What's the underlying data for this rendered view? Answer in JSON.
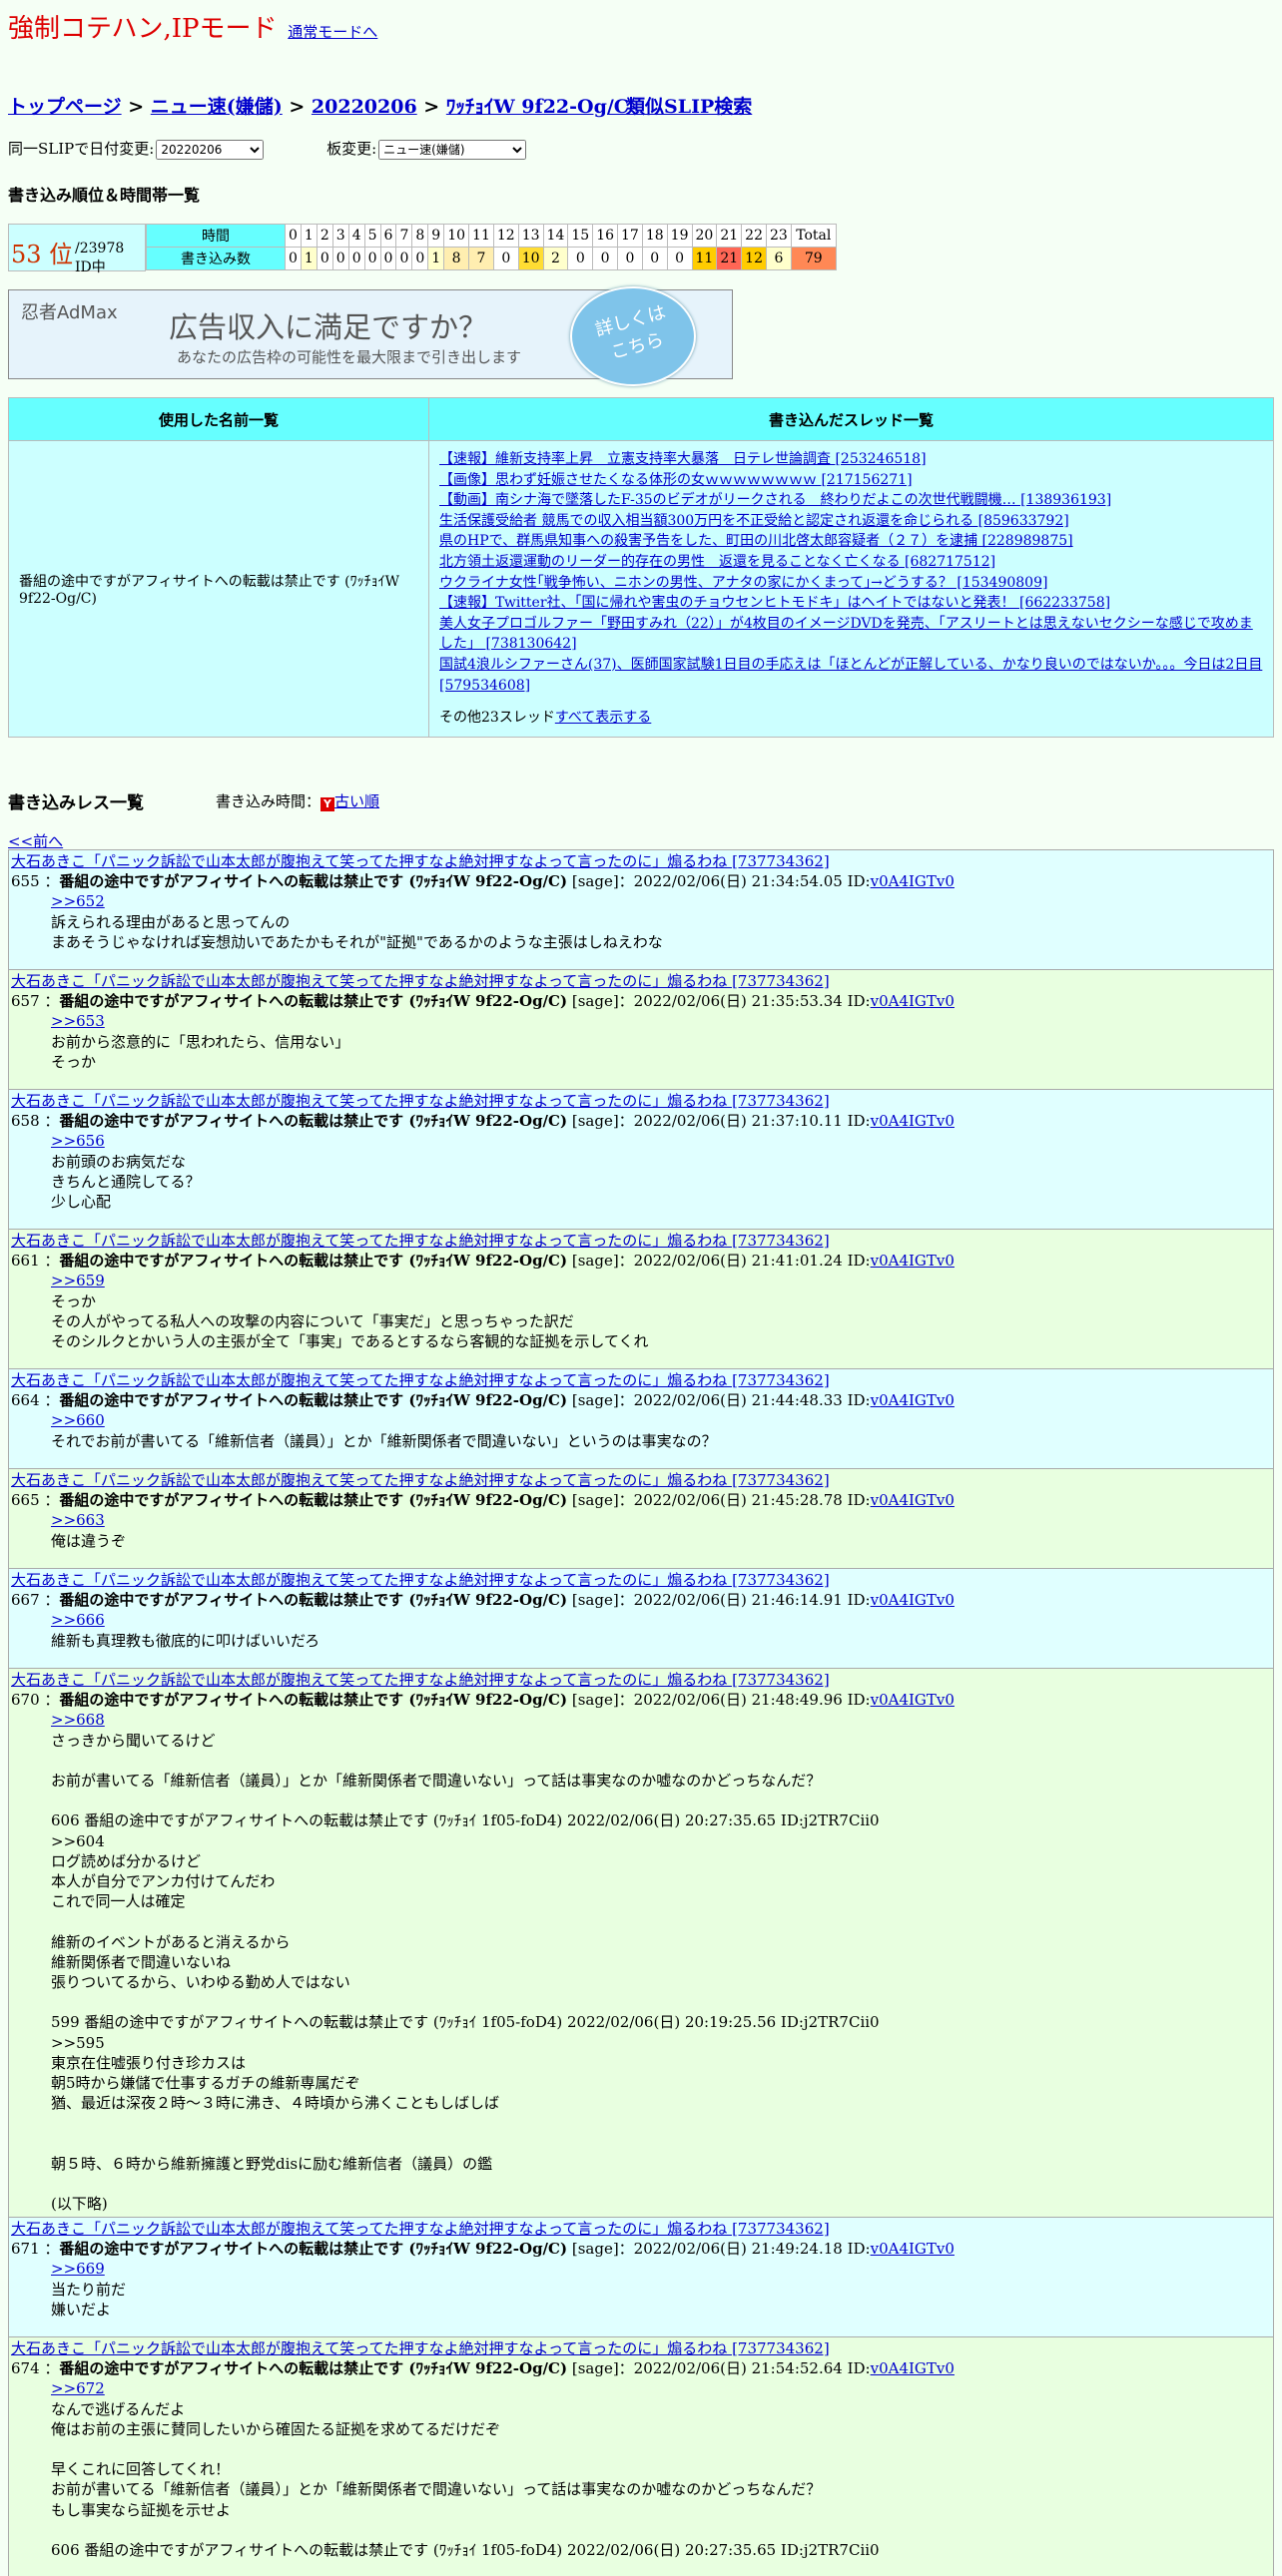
{
  "mode": {
    "title": "強制コテハン,IPモード",
    "normal_link": "通常モードへ"
  },
  "breadcrumb": {
    "top": "トップページ",
    "board": "ニュー速(嫌儲)",
    "date": "20220206",
    "slip": "ﾜｯﾁｮｲW 9f22-Og/C",
    "sep": " > "
  },
  "similar": "類似SLIP検索",
  "selects": {
    "date_label": "同一SLIPで日付変更:",
    "date_value": "20220206",
    "board_label": "板変更:",
    "board_value": "ニュー速(嫌儲)"
  },
  "ranking_title": "書き込み順位＆時間帯一覧",
  "rank": {
    "num": "53 位",
    "total": "/23978 ID中"
  },
  "hours": {
    "label_time": "時間",
    "label_count": "書き込み数",
    "cols": [
      "0",
      "1",
      "2",
      "3",
      "4",
      "5",
      "6",
      "7",
      "8",
      "9",
      "10",
      "11",
      "12",
      "13",
      "14",
      "15",
      "16",
      "17",
      "18",
      "19",
      "20",
      "21",
      "22",
      "23",
      "Total"
    ],
    "counts": [
      "0",
      "1",
      "0",
      "0",
      "0",
      "0",
      "0",
      "0",
      "0",
      "1",
      "8",
      "7",
      "0",
      "10",
      "2",
      "0",
      "0",
      "0",
      "0",
      "0",
      "11",
      "21",
      "12",
      "6",
      "79"
    ],
    "colors": [
      "#ffffff",
      "#ffffcc",
      "#ffffff",
      "#ffffff",
      "#ffffff",
      "#ffffff",
      "#ffffff",
      "#ffffff",
      "#ffffff",
      "#ffffcc",
      "#ffeeb0",
      "#ffeeb0",
      "#ffffff",
      "#ffdd33",
      "#ffffcc",
      "#ffffff",
      "#ffffff",
      "#ffffff",
      "#ffffff",
      "#ffffff",
      "#ffcc00",
      "#ff6655",
      "#ffcc00",
      "#ffffcc",
      "#ff8855"
    ]
  },
  "ad": {
    "logo": "忍者AdMax",
    "title": "広告収入に満足ですか？",
    "sub": "あなたの広告枠の可能性を最大限まで引き出します",
    "circle1": "詳しくは",
    "circle2": "こちら"
  },
  "names_table": {
    "h1": "使用した名前一覧",
    "h2": "書き込んだスレッド一覧",
    "name": "番組の途中ですがアフィサイトへの転載は禁止です (ﾜｯﾁｮｲW 9f22-Og/C)",
    "threads": [
      "【速報】維新支持率上昇　立憲支持率大暴落　日テレ世論調査 [253246518]",
      "【画像】思わず妊娠させたくなる体形の女ｗｗｗｗｗｗｗｗ [217156271]",
      "【動画】南シナ海で墜落したF-35のビデオがリークされる　終わりだよこの次世代戦闘機… [138936193]",
      "生活保護受給者 競馬での収入相当額300万円を不正受給と認定され返還を命じられる [859633792]",
      "県のHPで、群馬県知事への殺害予告をした、町田の川北啓太郎容疑者（２７）を逮捕 [228989875]",
      "北方領土返還運動のリーダー的存在の男性　返還を見ることなく亡くなる [682717512]",
      "ウクライナ女性｢戦争怖い、ニホンの男性、アナタの家にかくまって｣→どうする？ [153490809]",
      "【速報】Twitter社、「国に帰れや害虫のチョウセンヒトモドキ」はヘイトではないと発表！ [662233758]",
      "美人女子プロゴルファー「野田すみれ（22）」が4枚目のイメージDVDを発売、「アスリートとは思えないセクシーな感じで攻めました」 [738130642]",
      "国試4浪ルシファーさん(37)、医師国家試験1日目の手応えは「ほとんどが正解している、かなり良いのではないか。。。今日は2日目 [579534608]"
    ],
    "more_prefix": "その他23スレッド",
    "more_link": "すべて表示する"
  },
  "posts_title": "書き込みレス一覧",
  "order": {
    "label": "書き込み時間：",
    "icon": "Y",
    "link": "古い順"
  },
  "prev": "<<前へ",
  "posts": [
    {
      "thread": "大石あきこ「パニック訴訟で山本太郎が腹抱えて笑ってた押すなよ絶対押すなよって言ったのに」煽るわね [737734362]",
      "num": "655",
      "name": "番組の途中ですがアフィサイトへの転載は禁止です (ﾜｯﾁｮｲW 9f22-Og/C)",
      "meta": " [sage]：2022/02/06(日) 21:34:54.05 ID:",
      "id": "v0A4IGTv0",
      "anchor": ">>652",
      "body": "訴えられる理由があると思ってんの\nまあそうじゃなければ妄想劥いであたかもそれが\"証拠\"であるかのような主張はしねえわな"
    },
    {
      "thread": "大石あきこ「パニック訴訟で山本太郎が腹抱えて笑ってた押すなよ絶対押すなよって言ったのに」煽るわね [737734362]",
      "num": "657",
      "name": "番組の途中ですがアフィサイトへの転載は禁止です (ﾜｯﾁｮｲW 9f22-Og/C)",
      "meta": " [sage]：2022/02/06(日) 21:35:53.34 ID:",
      "id": "v0A4IGTv0",
      "anchor": ">>653",
      "body": "お前から恣意的に「思われたら、信用ない」\nそっか"
    },
    {
      "thread": "大石あきこ「パニック訴訟で山本太郎が腹抱えて笑ってた押すなよ絶対押すなよって言ったのに」煽るわね [737734362]",
      "num": "658",
      "name": "番組の途中ですがアフィサイトへの転載は禁止です (ﾜｯﾁｮｲW 9f22-Og/C)",
      "meta": " [sage]：2022/02/06(日) 21:37:10.11 ID:",
      "id": "v0A4IGTv0",
      "anchor": ">>656",
      "body": "お前頭のお病気だな\nきちんと通院してる？\n少し心配"
    },
    {
      "thread": "大石あきこ「パニック訴訟で山本太郎が腹抱えて笑ってた押すなよ絶対押すなよって言ったのに」煽るわね [737734362]",
      "num": "661",
      "name": "番組の途中ですがアフィサイトへの転載は禁止です (ﾜｯﾁｮｲW 9f22-Og/C)",
      "meta": " [sage]：2022/02/06(日) 21:41:01.24 ID:",
      "id": "v0A4IGTv0",
      "anchor": ">>659",
      "body": "そっか\nその人がやってる私人への攻撃の内容について「事実だ」と思っちゃった訳だ\nそのシルクとかいう人の主張が全て「事実」であるとするなら客観的な証拠を示してくれ"
    },
    {
      "thread": "大石あきこ「パニック訴訟で山本太郎が腹抱えて笑ってた押すなよ絶対押すなよって言ったのに」煽るわね [737734362]",
      "num": "664",
      "name": "番組の途中ですがアフィサイトへの転載は禁止です (ﾜｯﾁｮｲW 9f22-Og/C)",
      "meta": " [sage]：2022/02/06(日) 21:44:48.33 ID:",
      "id": "v0A4IGTv0",
      "anchor": ">>660",
      "body": "それでお前が書いてる「維新信者（議員）」とか「維新関係者で間違いない」というのは事実なの？"
    },
    {
      "thread": "大石あきこ「パニック訴訟で山本太郎が腹抱えて笑ってた押すなよ絶対押すなよって言ったのに」煽るわね [737734362]",
      "num": "665",
      "name": "番組の途中ですがアフィサイトへの転載は禁止です (ﾜｯﾁｮｲW 9f22-Og/C)",
      "meta": " [sage]：2022/02/06(日) 21:45:28.78 ID:",
      "id": "v0A4IGTv0",
      "anchor": ">>663",
      "body": "俺は違うぞ"
    },
    {
      "thread": "大石あきこ「パニック訴訟で山本太郎が腹抱えて笑ってた押すなよ絶対押すなよって言ったのに」煽るわね [737734362]",
      "num": "667",
      "name": "番組の途中ですがアフィサイトへの転載は禁止です (ﾜｯﾁｮｲW 9f22-Og/C)",
      "meta": " [sage]：2022/02/06(日) 21:46:14.91 ID:",
      "id": "v0A4IGTv0",
      "anchor": ">>666",
      "body": "維新も真理教も徹底的に叩けばいいだろ"
    },
    {
      "thread": "大石あきこ「パニック訴訟で山本太郎が腹抱えて笑ってた押すなよ絶対押すなよって言ったのに」煽るわね [737734362]",
      "num": "670",
      "name": "番組の途中ですがアフィサイトへの転載は禁止です (ﾜｯﾁｮｲW 9f22-Og/C)",
      "meta": " [sage]：2022/02/06(日) 21:48:49.96 ID:",
      "id": "v0A4IGTv0",
      "anchor": ">>668",
      "body": "さっきから聞いてるけど\n\nお前が書いてる「維新信者（議員）」とか「維新関係者で間違いない」って話は事実なのか嘘なのかどっちなんだ？\n\n606 番組の途中ですがアフィサイトへの転載は禁止です (ﾜｯﾁｮｲ 1f05-foD4) 2022/02/06(日) 20:27:35.65 ID:j2TR7Cii0\n>>604\nログ読めば分かるけど\n本人が自分でアンカ付けてんだわ\nこれで同一人は確定\n\n維新のイベントがあると消えるから\n維新関係者で間違いないね\n張りついてるから、いわゆる勤め人ではない\n\n599 番組の途中ですがアフィサイトへの転載は禁止です (ﾜｯﾁｮｲ 1f05-foD4) 2022/02/06(日) 20:19:25.56 ID:j2TR7Cii0\n>>595\n東京在住嘘張り付き珍カスは\n朝5時から嫌儲で仕事するガチの維新専属だぞ\n猶、最近は深夜２時～３時に沸き、４時頃から沸くこともしばしば\n\n\n朝５時、６時から維新擁護と野党disに励む維新信者（議員）の鑑\n\n(以下略)"
    },
    {
      "thread": "大石あきこ「パニック訴訟で山本太郎が腹抱えて笑ってた押すなよ絶対押すなよって言ったのに」煽るわね [737734362]",
      "num": "671",
      "name": "番組の途中ですがアフィサイトへの転載は禁止です (ﾜｯﾁｮｲW 9f22-Og/C)",
      "meta": " [sage]：2022/02/06(日) 21:49:24.18 ID:",
      "id": "v0A4IGTv0",
      "anchor": ">>669",
      "body": "当たり前だ\n嫌いだよ"
    },
    {
      "thread": "大石あきこ「パニック訴訟で山本太郎が腹抱えて笑ってた押すなよ絶対押すなよって言ったのに」煽るわね [737734362]",
      "num": "674",
      "name": "番組の途中ですがアフィサイトへの転載は禁止です (ﾜｯﾁｮｲW 9f22-Og/C)",
      "meta": " [sage]：2022/02/06(日) 21:54:52.64 ID:",
      "id": "v0A4IGTv0",
      "anchor": ">>672",
      "body": "なんで逃げるんだよ\n俺はお前の主張に賛同したいから確固たる証拠を求めてるだけだぞ\n\n早くこれに回答してくれ！\nお前が書いてる「維新信者（議員）」とか「維新関係者で間違いない」って話は事実なのか嘘なのかどっちなんだ？\nもし事実なら証拠を示せよ\n\n606 番組の途中ですがアフィサイトへの転載は禁止です (ﾜｯﾁｮｲ 1f05-foD4) 2022/02/06(日) 20:27:35.65 ID:j2TR7Cii0"
    }
  ]
}
